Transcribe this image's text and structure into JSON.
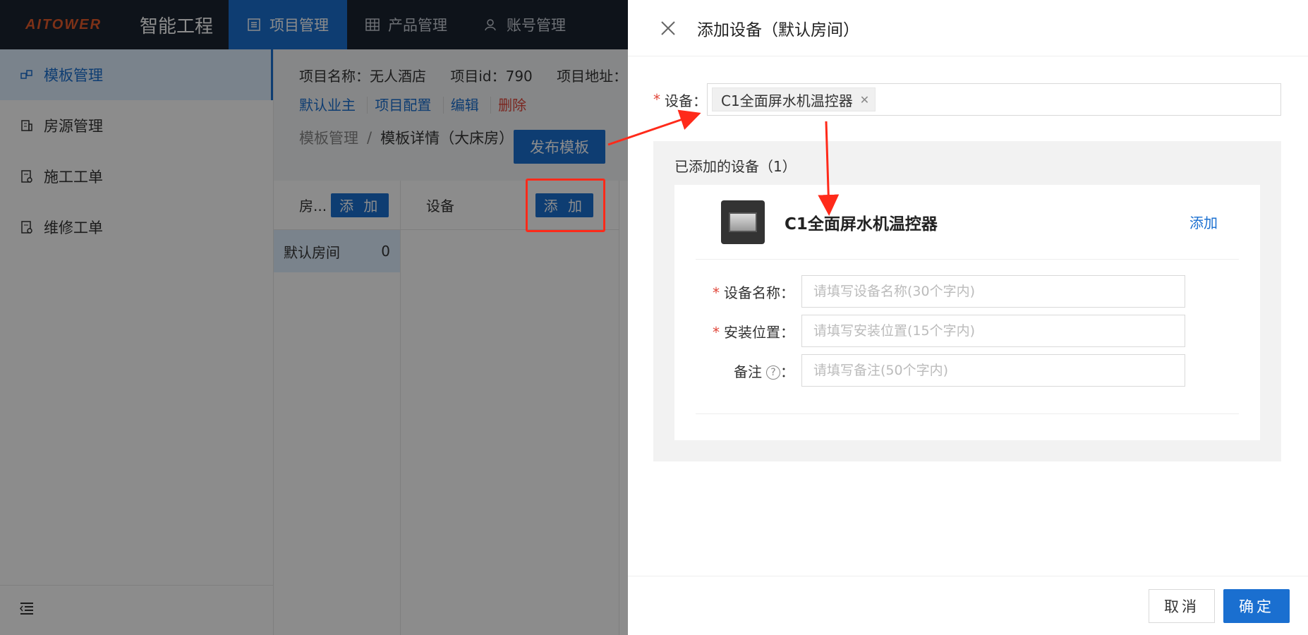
{
  "app": {
    "logo_text": "AITOWER",
    "title": "智能工程",
    "nav_tabs": [
      {
        "label": "项目管理",
        "icon": "list-icon"
      },
      {
        "label": "产品管理",
        "icon": "grid-icon"
      },
      {
        "label": "账号管理",
        "icon": "users-icon"
      }
    ]
  },
  "sidebar": {
    "items": [
      {
        "label": "模板管理",
        "icon": "template-icon"
      },
      {
        "label": "房源管理",
        "icon": "building-icon"
      },
      {
        "label": "施工工单",
        "icon": "order-icon"
      },
      {
        "label": "维修工单",
        "icon": "repair-order-icon"
      }
    ]
  },
  "project": {
    "name_label": "项目名称：无人酒店",
    "id_label": "项目id：790",
    "address_label": "项目地址：",
    "links": [
      "默认业主",
      "项目配置",
      "编辑",
      "删除"
    ]
  },
  "breadcrumb": {
    "parent": "模板管理",
    "separator": "/",
    "current": "模板详情（大床房）"
  },
  "publish_button": "发布模板",
  "rooms_panel": {
    "head": "房...",
    "add_label": "添 加",
    "rooms": [
      {
        "name": "默认房间",
        "count": "0"
      }
    ]
  },
  "devices_panel": {
    "head": "设备",
    "add_label": "添 加"
  },
  "drawer": {
    "title": "添加设备（默认房间）",
    "device_label": "设备：",
    "selected_tag": "C1全面屏水机温控器",
    "added_title": "已添加的设备（1）",
    "card": {
      "name": "C1全面屏水机温控器",
      "add_link": "添加",
      "fields": [
        {
          "label": "设备名称：",
          "placeholder": "请填写设备名称(30个字内)",
          "required": true
        },
        {
          "label": "安装位置：",
          "placeholder": "请填写安装位置(15个字内)",
          "required": true
        },
        {
          "label": "备注",
          "placeholder": "请填写备注(50个字内)",
          "required": false
        }
      ]
    },
    "cancel_label": "取消",
    "ok_label": "确定"
  },
  "colors": {
    "primary": "#1a6fd0",
    "danger": "#e0463a",
    "annotation": "#ff2a1a"
  }
}
